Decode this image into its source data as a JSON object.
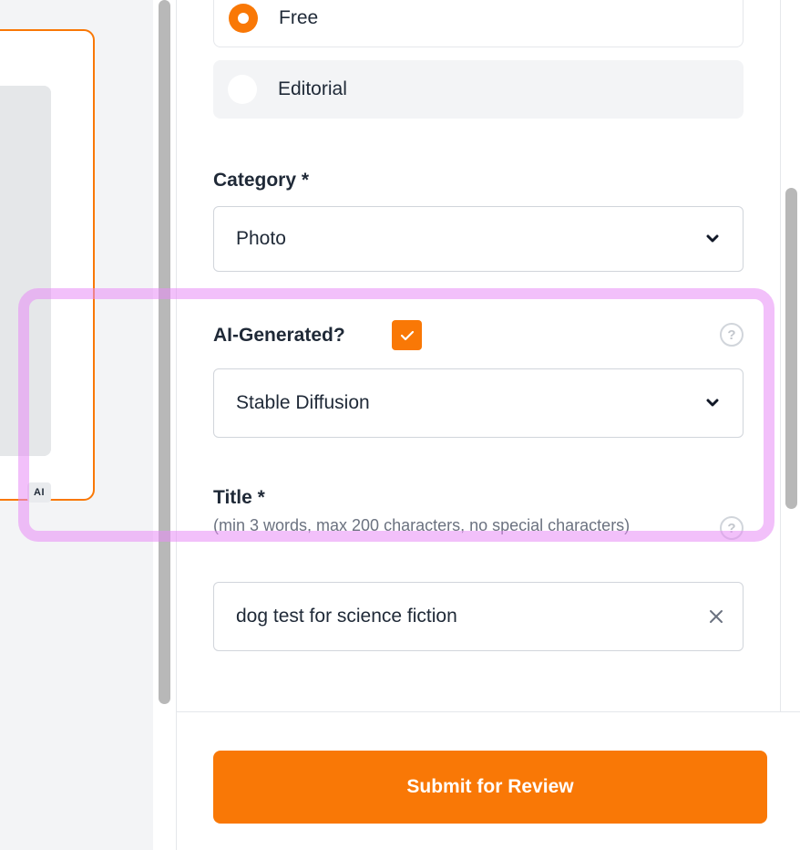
{
  "license": {
    "options": [
      {
        "label": "Free",
        "selected": true
      },
      {
        "label": "Editorial",
        "selected": false
      }
    ]
  },
  "category": {
    "label": "Category *",
    "value": "Photo"
  },
  "ai_generated": {
    "label": "AI-Generated?",
    "checked": true,
    "model_value": "Stable Diffusion",
    "help_icon": "?"
  },
  "title_field": {
    "label": "Title *",
    "helper": "(min 3 words, max 200 characters, no special characters)",
    "value": "dog test for science fiction",
    "help_icon": "?"
  },
  "image_card": {
    "badge": "AI"
  },
  "submit": {
    "label": "Submit for Review"
  },
  "colors": {
    "accent": "#f97806",
    "highlight": "#e88cf5"
  }
}
